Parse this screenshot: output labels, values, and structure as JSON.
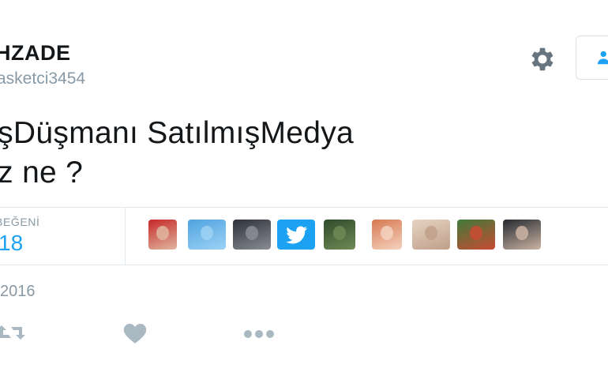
{
  "profile": {
    "display_name": "HZADE",
    "handle": "asketci3454"
  },
  "header": {
    "settings_icon": "gear-icon",
    "follow_icon": "user-plus-icon"
  },
  "tweet": {
    "lines": [
      "ışDüşmanı SatılmışMedya",
      "ız ne ?"
    ]
  },
  "stats": {
    "likes_label": "BEĞENİ",
    "likes_count": "18",
    "avatars": [
      {
        "name": "avatar-1",
        "colors": [
          "#c62828",
          "#e0b6a0"
        ]
      },
      {
        "name": "avatar-2",
        "colors": [
          "#4fa3e0",
          "#9dd2f5"
        ]
      },
      {
        "name": "avatar-3",
        "colors": [
          "#2c3038",
          "#8a8d95"
        ]
      },
      {
        "name": "avatar-4",
        "colors": [
          "#1da1f2",
          "#1da1f2"
        ]
      },
      {
        "name": "avatar-5",
        "colors": [
          "#2f4a2a",
          "#6f8a55"
        ]
      },
      {
        "name": "avatar-6",
        "colors": [
          "#d77a52",
          "#f4d2bf"
        ]
      },
      {
        "name": "avatar-7",
        "colors": [
          "#e6d3c2",
          "#bfa08a"
        ]
      },
      {
        "name": "avatar-8",
        "colors": [
          "#3f7a3a",
          "#c94b33"
        ]
      },
      {
        "name": "avatar-9",
        "colors": [
          "#262a31",
          "#cbb4a3"
        ]
      }
    ]
  },
  "meta": {
    "date": "2016"
  },
  "actions": {
    "retweet_icon": "retweet-icon",
    "like_icon": "heart-icon",
    "more_icon": "more-dots-icon"
  },
  "colors": {
    "accent": "#1da1f2",
    "muted": "#8899a6",
    "text": "#14171a",
    "border": "#e1e8ed"
  }
}
